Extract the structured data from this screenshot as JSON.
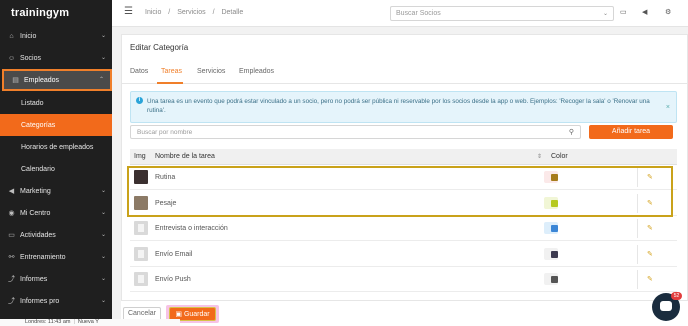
{
  "app": {
    "logo": "trainingym"
  },
  "sidebar": {
    "items": [
      {
        "label": "Inicio",
        "icon": "home-icon",
        "glyph": "⌂"
      },
      {
        "label": "Socios",
        "icon": "users-icon",
        "glyph": "☺"
      },
      {
        "label": "Empleados",
        "icon": "id-card-icon",
        "glyph": "▤"
      },
      {
        "label": "Marketing",
        "icon": "megaphone-icon",
        "glyph": "◀"
      },
      {
        "label": "Mi Centro",
        "icon": "location-pin-icon",
        "glyph": "◉"
      },
      {
        "label": "Actividades",
        "icon": "folder-icon",
        "glyph": "▭"
      },
      {
        "label": "Entrenamiento",
        "icon": "dumbbell-icon",
        "glyph": "⚯"
      },
      {
        "label": "Informes",
        "icon": "chart-line-icon",
        "glyph": "⤴"
      },
      {
        "label": "Informes pro",
        "icon": "chart-pro-icon",
        "glyph": "⤴"
      }
    ],
    "sub_items": [
      {
        "label": "Listado"
      },
      {
        "label": "Categorías"
      },
      {
        "label": "Horarios de empleados"
      },
      {
        "label": "Calendario"
      }
    ]
  },
  "topbar": {
    "breadcrumb": [
      "Inicio",
      "/",
      "Servicios",
      "/",
      "Detalle"
    ],
    "search_placeholder": "Buscar Socios",
    "icons": {
      "menu_icon_glyph": "☰",
      "card_icon_glyph": "▭",
      "megaphone_icon_glyph": "◀",
      "settings_icon_glyph": "⚙",
      "dropdown_arrow_glyph": "⌄"
    }
  },
  "card": {
    "title": "Editar Categoría",
    "tabs": [
      "Datos",
      "Tareas",
      "Servicios",
      "Empleados"
    ],
    "active_tab": "Tareas",
    "info_text": "Una tarea es un evento que podrá estar vinculado a un socio, pero no podrá ser pública ni reservable por los socios desde la app o web. Ejemplos: 'Recoger la sala' o 'Renovar una rutina'.",
    "info_icon_glyph": "i",
    "info_close_glyph": "×",
    "filter_placeholder": "Buscar por nombre",
    "search_icon_glyph": "⚲",
    "add_button": "Añadir tarea",
    "table": {
      "headers": {
        "img": "Img",
        "name": "Nombre de la tarea",
        "color": "Color"
      },
      "sort_glyph": "⇕",
      "edit_glyph": "✎",
      "rows": [
        {
          "name": "Rutina",
          "color": "#a67c1c",
          "thumb": "#3b3030",
          "wrap": "#fbe9e9"
        },
        {
          "name": "Pesaje",
          "color": "#b6c91f",
          "thumb": "#8c7a66",
          "wrap": "#f1f6d6"
        },
        {
          "name": "Entrevista o interacción",
          "color": "#3b86d6",
          "thumb": "doc",
          "wrap": "#ddeefb"
        },
        {
          "name": "Envío Email",
          "color": "#3c3a4f",
          "thumb": "doc",
          "wrap": "#f1f1f1"
        },
        {
          "name": "Envío Push",
          "color": "#555555",
          "thumb": "doc",
          "wrap": "#f1f1f1"
        }
      ]
    }
  },
  "footer": {
    "cancel": "Cancelar",
    "save": "Guardar",
    "save_icon_glyph": "▣"
  },
  "chat": {
    "badge": "52"
  },
  "status_bar": {
    "items": [
      "Londres: 11:43 am",
      "Nueva Y"
    ]
  }
}
